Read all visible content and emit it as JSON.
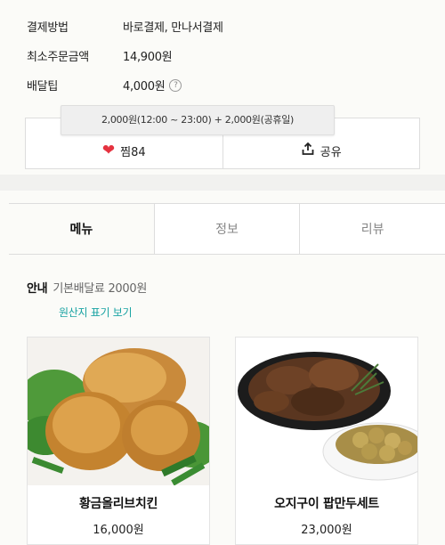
{
  "store_info": {
    "payment": {
      "label": "결제방법",
      "value": "바로결제, 만나서결제"
    },
    "min_order": {
      "label": "최소주문금액",
      "value": "14,900원"
    },
    "delivery_tip": {
      "label": "배달팁",
      "value": "4,000원",
      "help_icon": "question-circle-icon"
    }
  },
  "tooltip": {
    "text": "2,000원(12:00 ~ 23:00) + 2,000원(공휴일)"
  },
  "actions": {
    "favorite": {
      "icon": "heart-icon",
      "label": "찜84",
      "color": "#e5323f"
    },
    "share": {
      "icon": "share-icon",
      "label": "공유"
    }
  },
  "tabs": [
    {
      "label": "메뉴",
      "active": true
    },
    {
      "label": "정보",
      "active": false
    },
    {
      "label": "리뷰",
      "active": false
    }
  ],
  "notice": {
    "tag": "안내",
    "text": "기본배달료 2000원"
  },
  "origin_link": {
    "label": "원산지 표기 보기",
    "color": "#1aa3a3"
  },
  "menu_items": [
    {
      "name": "황금올리브치킨",
      "price": "16,000원",
      "image": "fried-chicken-photo"
    },
    {
      "name": "오지구이 팝만두세트",
      "price": "23,000원",
      "image": "roasted-wings-dumplings-photo"
    }
  ]
}
